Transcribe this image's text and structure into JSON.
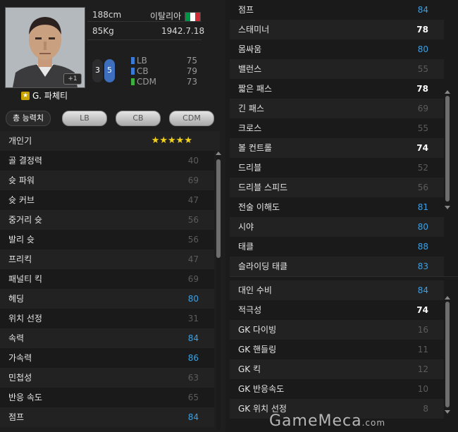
{
  "player": {
    "name": "G. 파체티",
    "height": "188cm",
    "weight": "85Kg",
    "country": "이탈리아",
    "birth": "1942.7.18",
    "plus": "+1",
    "flag_colors": [
      "#009246",
      "#ffffff",
      "#ce2b37"
    ]
  },
  "feet": {
    "left": "3",
    "right": "5"
  },
  "positions": [
    {
      "label": "LB",
      "value": "75",
      "color": "#3a7cd5"
    },
    {
      "label": "CB",
      "value": "79",
      "color": "#3a7cd5"
    },
    {
      "label": "CDM",
      "value": "73",
      "color": "#3fae3f"
    }
  ],
  "tabs": [
    "총 능력치",
    "LB",
    "CB",
    "CDM"
  ],
  "skill": {
    "label": "개인기",
    "stars": "★★★★★"
  },
  "left_stats": [
    {
      "label": "골 결정력",
      "value": "40",
      "tone": "low"
    },
    {
      "label": "슛 파워",
      "value": "69",
      "tone": "low"
    },
    {
      "label": "슛 커브",
      "value": "47",
      "tone": "low"
    },
    {
      "label": "중거리 슛",
      "value": "56",
      "tone": "low"
    },
    {
      "label": "발리 슛",
      "value": "56",
      "tone": "low"
    },
    {
      "label": "프리킥",
      "value": "47",
      "tone": "low"
    },
    {
      "label": "패널티 킥",
      "value": "69",
      "tone": "low"
    },
    {
      "label": "헤딩",
      "value": "80",
      "tone": "blue"
    },
    {
      "label": "위치 선정",
      "value": "31",
      "tone": "low"
    },
    {
      "label": "속력",
      "value": "84",
      "tone": "blue"
    },
    {
      "label": "가속력",
      "value": "86",
      "tone": "blue"
    },
    {
      "label": "민첩성",
      "value": "63",
      "tone": "low"
    },
    {
      "label": "반응 속도",
      "value": "65",
      "tone": "low"
    },
    {
      "label": "점프",
      "value": "84",
      "tone": "blue"
    }
  ],
  "right_stats_top": [
    {
      "label": "점프",
      "value": "84",
      "tone": "blue"
    },
    {
      "label": "스태미너",
      "value": "78",
      "tone": "hi"
    },
    {
      "label": "몸싸움",
      "value": "80",
      "tone": "blue"
    },
    {
      "label": "밸런스",
      "value": "55",
      "tone": "low"
    },
    {
      "label": "짧은 패스",
      "value": "78",
      "tone": "hi"
    },
    {
      "label": "긴 패스",
      "value": "69",
      "tone": "low"
    },
    {
      "label": "크로스",
      "value": "55",
      "tone": "low"
    },
    {
      "label": "볼 컨트롤",
      "value": "74",
      "tone": "hi"
    },
    {
      "label": "드리블",
      "value": "52",
      "tone": "low"
    },
    {
      "label": "드리블 스피드",
      "value": "56",
      "tone": "low"
    },
    {
      "label": "전술 이해도",
      "value": "81",
      "tone": "blue"
    },
    {
      "label": "시야",
      "value": "80",
      "tone": "blue"
    },
    {
      "label": "태클",
      "value": "88",
      "tone": "blue"
    },
    {
      "label": "슬라이딩 태클",
      "value": "83",
      "tone": "blue"
    }
  ],
  "right_stats_bottom": [
    {
      "label": "대인 수비",
      "value": "84",
      "tone": "blue"
    },
    {
      "label": "적극성",
      "value": "74",
      "tone": "hi"
    },
    {
      "label": "GK 다이빙",
      "value": "16",
      "tone": "low"
    },
    {
      "label": "GK 핸들링",
      "value": "11",
      "tone": "low"
    },
    {
      "label": "GK 킥",
      "value": "12",
      "tone": "low"
    },
    {
      "label": "GK 반응속도",
      "value": "10",
      "tone": "low"
    },
    {
      "label": "GK 위치 선정",
      "value": "8",
      "tone": "low"
    }
  ],
  "watermark": {
    "main": "GameMeca",
    "suffix": ".com"
  }
}
